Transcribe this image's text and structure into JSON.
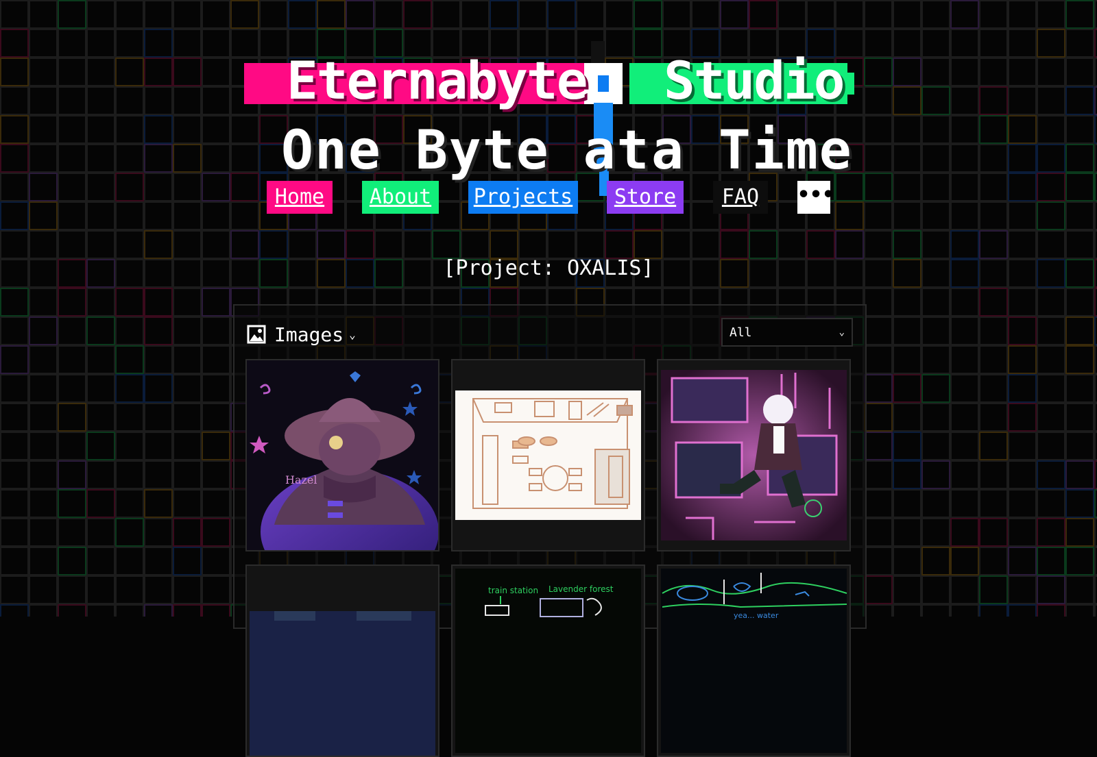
{
  "logo": {
    "title_left": "Eternabyte",
    "title_right": "Studio",
    "tagline_left": "One Byte at",
    "tagline_right": "a Time"
  },
  "nav": {
    "items": [
      {
        "label": "Home",
        "color": "#ff0a84"
      },
      {
        "label": "About",
        "color": "#11ee7a"
      },
      {
        "label": "Projects",
        "color": "#0d7cf2"
      },
      {
        "label": "Store",
        "color": "#8c3cf2"
      },
      {
        "label": "FAQ",
        "color": "#0d0d0d"
      }
    ],
    "more_label": "•••",
    "more_icon": "ellipsis-icon"
  },
  "project": {
    "title": "[Project: OXALIS]"
  },
  "gallery": {
    "section_label": "Images",
    "section_icon": "image-icon",
    "filter": {
      "selected": "All",
      "icon": "chevron-down-icon"
    },
    "tiles": [
      {
        "alt": "artwork-hazel",
        "caption": "Hazel"
      },
      {
        "alt": "artwork-room-sketch"
      },
      {
        "alt": "artwork-screens-character"
      },
      {
        "alt": "artwork-dark-scene"
      },
      {
        "alt": "artwork-map-sketch",
        "caption_a": "train station",
        "caption_b": "Lavender forest"
      },
      {
        "alt": "artwork-path-sketch",
        "caption_a": "yea... water"
      }
    ]
  },
  "colors": {
    "pink": "#ff0a84",
    "green": "#11ee7a",
    "blue": "#0d7cf2",
    "purple": "#8c3cf2",
    "background": "#050505"
  }
}
